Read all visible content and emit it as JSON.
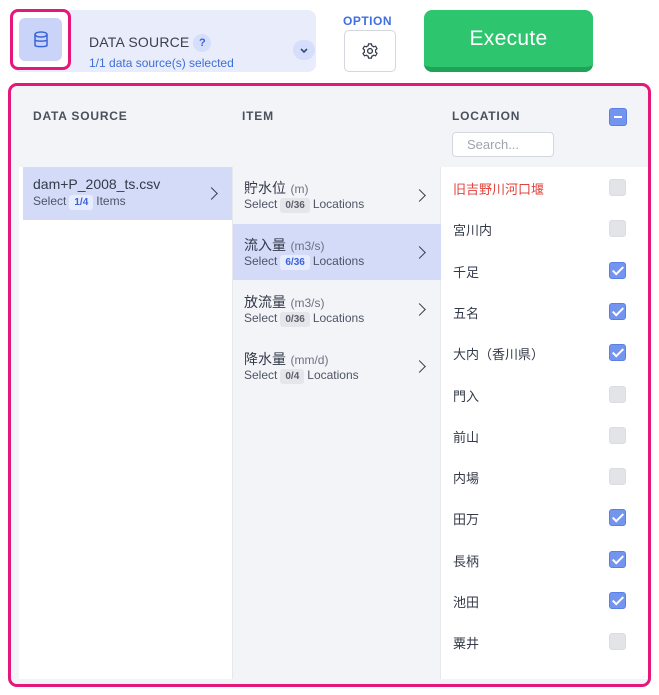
{
  "data_source": {
    "title": "DATA SOURCE",
    "help": "?",
    "subtitle": "1/1 data source(s) selected",
    "icon": "database-icon"
  },
  "option": {
    "label": "OPTION",
    "icon": "gear-icon"
  },
  "execute": {
    "label": "Execute",
    "color": "#2ec56f"
  },
  "headers": {
    "data_source": "DATA SOURCE",
    "item": "ITEM",
    "location": "LOCATION"
  },
  "search": {
    "placeholder": "Search..."
  },
  "data_sources": [
    {
      "name": "dam+P_2008_ts.csv",
      "select": "Select",
      "count": "1/4",
      "suffix": "Items",
      "selected": true
    }
  ],
  "items": [
    {
      "name": "貯水位",
      "unit": "(m)",
      "select": "Select",
      "count": "0/36",
      "suffix": "Locations",
      "selected": false
    },
    {
      "name": "流入量",
      "unit": "(m3/s)",
      "select": "Select",
      "count": "6/36",
      "suffix": "Locations",
      "selected": true
    },
    {
      "name": "放流量",
      "unit": "(m3/s)",
      "select": "Select",
      "count": "0/36",
      "suffix": "Locations",
      "selected": false
    },
    {
      "name": "降水量",
      "unit": "(mm/d)",
      "select": "Select",
      "count": "0/4",
      "suffix": "Locations",
      "selected": false
    }
  ],
  "locations": [
    {
      "name": "旧吉野川河口堰",
      "checked": false,
      "highlight": true
    },
    {
      "name": "宮川内",
      "checked": false,
      "highlight": false
    },
    {
      "name": "千足",
      "checked": true,
      "highlight": false
    },
    {
      "name": "五名",
      "checked": true,
      "highlight": false
    },
    {
      "name": "大内（香川県）",
      "checked": true,
      "highlight": false
    },
    {
      "name": "門入",
      "checked": false,
      "highlight": false
    },
    {
      "name": "前山",
      "checked": false,
      "highlight": false
    },
    {
      "name": "内場",
      "checked": false,
      "highlight": false
    },
    {
      "name": "田万",
      "checked": true,
      "highlight": false
    },
    {
      "name": "長柄",
      "checked": true,
      "highlight": false
    },
    {
      "name": "池田",
      "checked": true,
      "highlight": false
    },
    {
      "name": "粟井",
      "checked": false,
      "highlight": false
    }
  ],
  "colors": {
    "accent": "#3b6fd8",
    "highlight_border": "#e6177a",
    "selected_row": "#d3dbf9",
    "checked": "#7395f0"
  }
}
